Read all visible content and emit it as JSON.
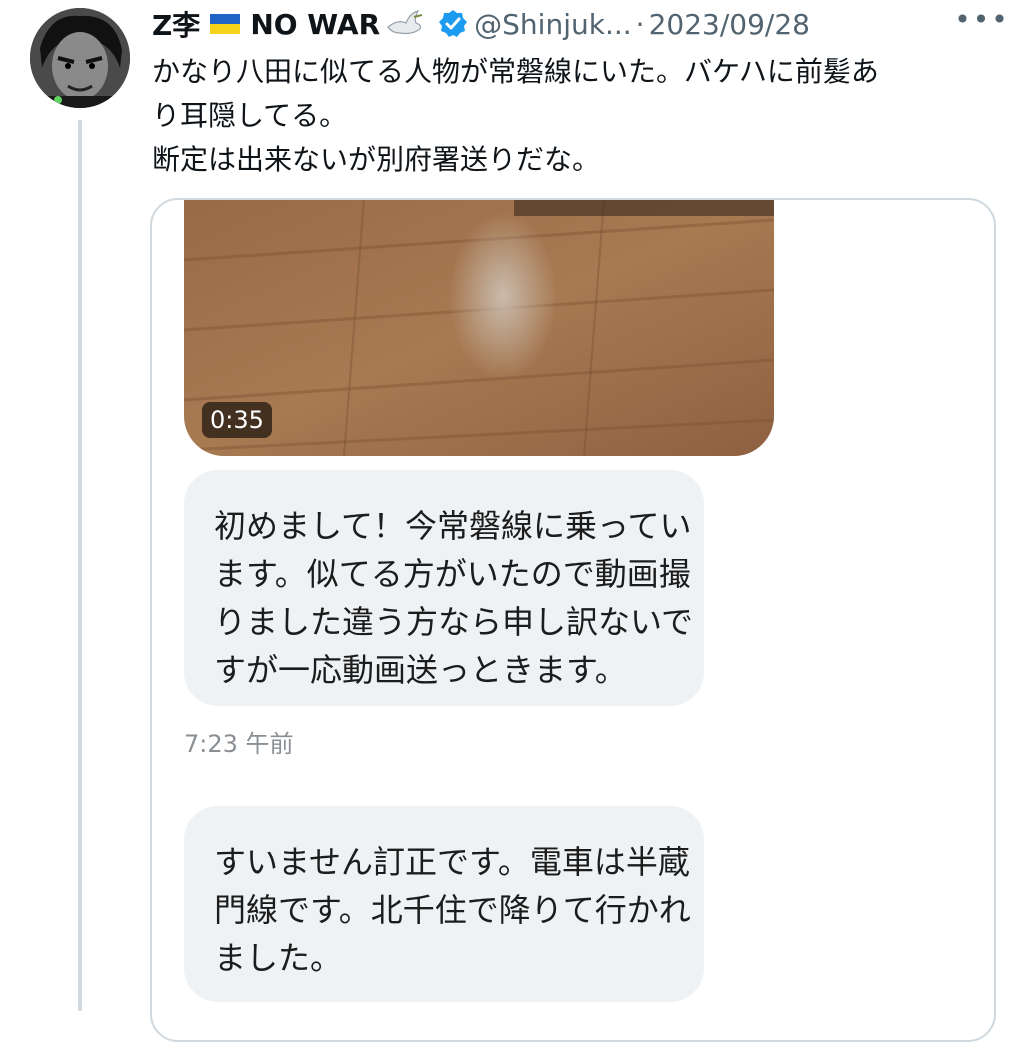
{
  "tweet": {
    "author_name": "Z李",
    "name_suffix": "NO WAR",
    "flag_icon": "ukraine-flag-icon",
    "dove_icon": "dove-icon",
    "verified_icon": "verified-badge-icon",
    "handle": "@Shinjuk...",
    "separator": "·",
    "date": "2023/09/28",
    "more_icon": "more-horizontal-icon",
    "more_label": "•••",
    "text_lines": [
      "かなり八田に似てる人物が常磐線にいた。バケハに前髪あ",
      "り耳隠してる。",
      "断定は出来ないが別府署送りだな。"
    ]
  },
  "media": {
    "video_duration": "0:35",
    "messages": [
      {
        "lines": [
          "初めまして！今常磐線に乗ってい",
          "ます。似てる方がいたので動画撮",
          "りました違う方なら申し訳ないで",
          "すが一応動画送っときます。"
        ],
        "time": "7:23 午前"
      },
      {
        "lines": [
          "すいません訂正です。電車は半蔵",
          "門線です。北千住で降りて行かれ",
          "ました。"
        ]
      }
    ]
  },
  "colors": {
    "text_primary": "#0f1419",
    "text_secondary": "#536471",
    "verified_blue": "#1d9bf0",
    "bubble_bg": "#eff2f4",
    "card_border": "#cfd9de"
  }
}
